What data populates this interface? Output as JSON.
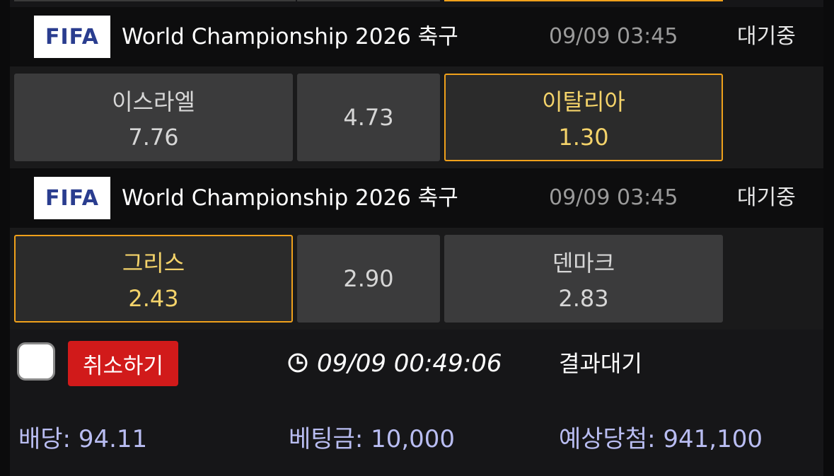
{
  "matches": [
    {
      "logo_text": "FIFA",
      "league": "World Championship 2026 축구",
      "datetime": "09/09 03:45",
      "status": "대기중",
      "home": {
        "team": "이스라엘",
        "odds": "7.76",
        "selected": false
      },
      "draw": {
        "odds": "4.73"
      },
      "away": {
        "team": "이탈리아",
        "odds": "1.30",
        "selected": true
      }
    },
    {
      "logo_text": "FIFA",
      "league": "World Championship 2026 축구",
      "datetime": "09/09 03:45",
      "status": "대기중",
      "home": {
        "team": "그리스",
        "odds": "2.43",
        "selected": true
      },
      "draw": {
        "odds": "2.90"
      },
      "away": {
        "team": "덴마크",
        "odds": "2.83",
        "selected": false
      }
    }
  ],
  "controls": {
    "cancel_label": "취소하기",
    "bet_time": "09/09 00:49:06",
    "result_status": "결과대기"
  },
  "summary": {
    "odds": "배당: 94.11",
    "stake": "베팅금: 10,000",
    "expected_win": "예상당첨: 941,100"
  },
  "colors": {
    "selected_border": "#f0a11b",
    "selected_text": "#f4d36a",
    "cancel_button": "#d11a1a",
    "summary_text": "#b9bdf2"
  },
  "icons": {
    "clock": "clock-icon"
  }
}
